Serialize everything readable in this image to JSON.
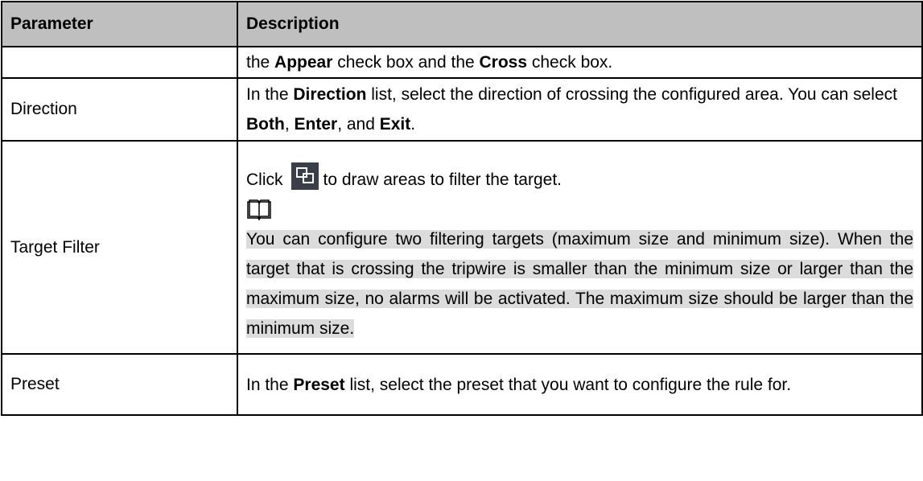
{
  "table": {
    "header": {
      "parameter": "Parameter",
      "description": "Description"
    },
    "rows": [
      {
        "parameter": "",
        "desc_parts": [
          "the ",
          "Appear",
          " check box and the ",
          "Cross",
          " check box."
        ]
      },
      {
        "parameter": "Direction",
        "desc_parts": [
          "In the ",
          "Direction",
          " list, select the direction of crossing the configured area. You can select ",
          "Both",
          ", ",
          "Enter",
          ", and ",
          "Exit",
          "."
        ]
      },
      {
        "parameter": "Target Filter",
        "click_text": "Click",
        "after_icon_text": "to draw areas to filter the target.",
        "icon": "draw-area-icon",
        "note_icon": "book-note-icon",
        "note_text": "You can configure two filtering targets (maximum size and minimum size). When the target that is crossing the tripwire is smaller than the minimum size or larger than the maximum size, no alarms will be activated. The maximum size should be larger than the minimum size."
      },
      {
        "parameter": "Preset",
        "desc_parts": [
          "In the ",
          "Preset",
          " list, select the preset that you want to configure the rule for."
        ]
      }
    ]
  },
  "colors": {
    "header_bg": "#bfbfbf",
    "note_highlight": "#dcdcdc",
    "icon_bg": "#3a3f47"
  }
}
